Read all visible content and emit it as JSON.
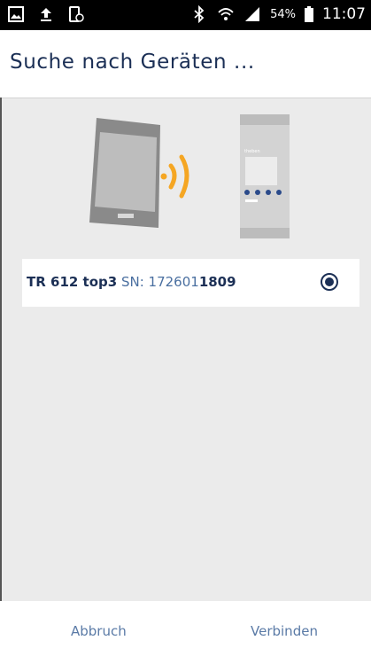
{
  "status_bar": {
    "left_icons": [
      "image-icon",
      "upload-icon",
      "phone-clock-icon"
    ],
    "right_icons": [
      "bluetooth-icon",
      "wifi-icon",
      "signal-icon"
    ],
    "battery": "54%",
    "time": "11:07"
  },
  "appbar": {
    "title": "Suche nach Geräten ..."
  },
  "illustration": {
    "device_brand": "theben"
  },
  "devices": [
    {
      "name": "TR 612 top3",
      "sn_label": "SN:",
      "sn_prefix": "172601",
      "sn_suffix": "1809",
      "selected": true
    }
  ],
  "actions": {
    "cancel": "Abbruch",
    "connect": "Verbinden"
  },
  "colors": {
    "accent": "#1b2f55",
    "signal": "#f5a623",
    "background": "#ebebeb"
  }
}
